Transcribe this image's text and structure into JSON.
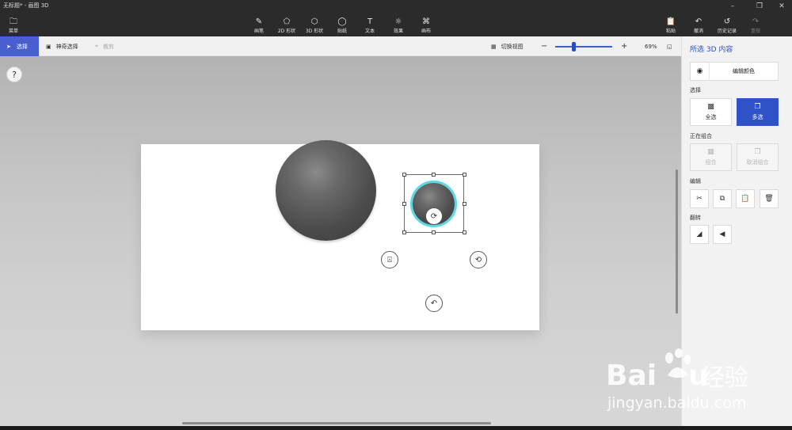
{
  "window": {
    "title": "无标题* - 画图 3D"
  },
  "toolbar": {
    "menu": "菜单",
    "brushes": "画笔",
    "shapes2d": "2D 形状",
    "shapes3d": "3D 形状",
    "stickers": "贴纸",
    "text": "文本",
    "effects": "效果",
    "canvas": "画布",
    "paste": "粘贴",
    "undo": "撤消",
    "history": "历史记录",
    "redo": "重做"
  },
  "subbar": {
    "select": "选择",
    "magic_select": "神奇选择",
    "crop": "裁剪",
    "toggle_view": "切换视图",
    "zoom": "69%"
  },
  "panel": {
    "title": "所选 3D 内容",
    "edit_color": "编辑颜色",
    "select_label": "选择",
    "select_all": "全选",
    "multi_select": "多选",
    "grouping_label": "正在组合",
    "group": "组合",
    "ungroup": "取消组合",
    "edit_label": "编辑",
    "flip_label": "翻转"
  },
  "help": "?",
  "watermark": {
    "brand": "Bai",
    "brand_end": "u",
    "jingyan": "经验",
    "url": "jingyan.baidu.com"
  },
  "colors": {
    "accent": "#2f52c6",
    "select_highlight": "#5ed6e6",
    "sphere": "#4c4c4c"
  },
  "icons": {
    "menu": "folder-icon",
    "brush": "brush-icon",
    "shape2d": "shape-2d-icon",
    "shape3d": "cube-icon",
    "sticker": "sticker-icon",
    "text": "text-icon",
    "effects": "sun-icon",
    "canvas": "canvas-icon",
    "paste": "paste-icon",
    "undo": "undo-icon",
    "history": "history-icon",
    "redo": "redo-icon"
  }
}
